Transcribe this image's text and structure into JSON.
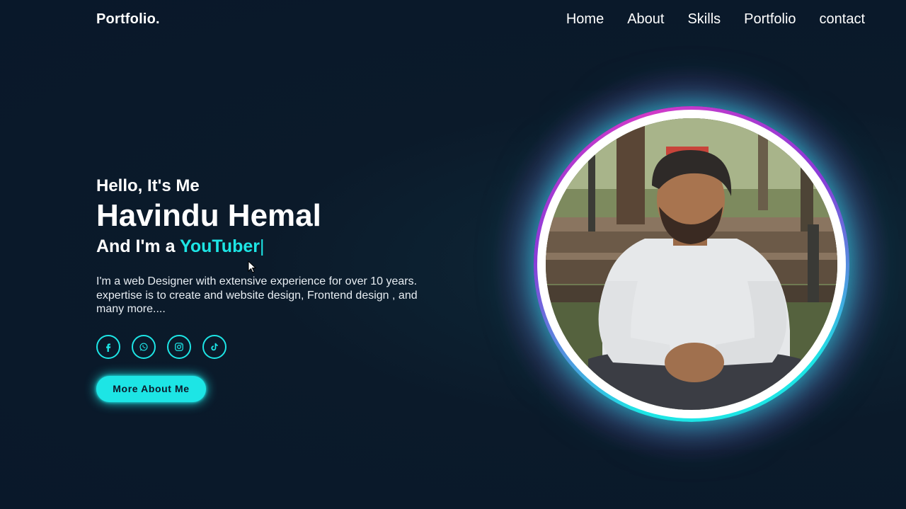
{
  "header": {
    "logo": "Portfolio.",
    "nav": [
      {
        "label": "Home"
      },
      {
        "label": "About"
      },
      {
        "label": "Skills"
      },
      {
        "label": "Portfolio"
      },
      {
        "label": "contact"
      }
    ]
  },
  "hero": {
    "greeting": "Hello, It's Me",
    "name": "Havindu Hemal",
    "role_prefix": "And I'm a ",
    "role_highlight": "YouTuber",
    "role_cursor": "|",
    "bio": "I'm a web Designer with extensive experience for over 10 years. expertise is to create and website design, Frontend design , and many more....",
    "socials": [
      {
        "icon": "facebook-icon"
      },
      {
        "icon": "whatsapp-icon"
      },
      {
        "icon": "instagram-icon"
      },
      {
        "icon": "tiktok-icon"
      }
    ],
    "cta_label": "More About Me"
  },
  "colors": {
    "background": "#0b1a2a",
    "accent": "#1de5e5",
    "ring_purple": "#d23ac8",
    "text": "#ffffff"
  }
}
